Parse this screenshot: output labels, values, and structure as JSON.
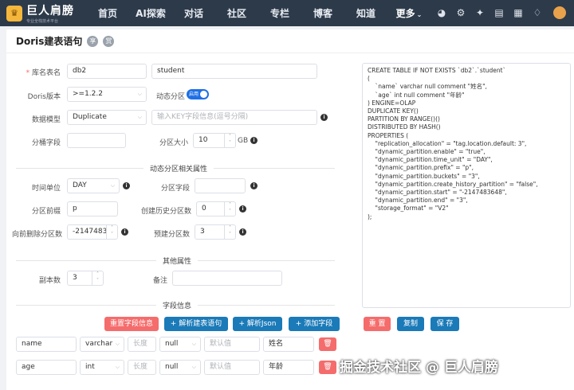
{
  "topbar": {
    "logo_text": "巨人肩膀",
    "logo_sub": "专业全栈技术平台",
    "nav": [
      "首页",
      "AI探索",
      "对话",
      "社区",
      "专栏",
      "博客",
      "知道",
      "更多"
    ],
    "icons": [
      "dashboard-icon",
      "robot-icon",
      "magic-wand-icon",
      "document-icon",
      "calendar-icon",
      "bell-icon",
      "avatar"
    ]
  },
  "page": {
    "title": "Doris建表语句",
    "circle_btn_1": "享",
    "circle_btn_2": "赏"
  },
  "form": {
    "db_label": "库名表名",
    "db_value": "db2",
    "table_value": "student",
    "version_label": "Doris版本",
    "version_value": ">=1.2.2",
    "dynamic_label": "动态分区",
    "dynamic_toggle": "启用",
    "model_label": "数据模型",
    "model_value": "Duplicate",
    "key_placeholder": "输入KEY字段信息(逗号分隔)",
    "bucket_label": "分桶字段",
    "bucket_value": "",
    "partsize_label": "分区大小",
    "partsize_value": "10",
    "partsize_unit": "GB"
  },
  "dynamic": {
    "section_title": "动态分区相关属性",
    "timeunit_label": "时间单位",
    "timeunit_value": "DAY",
    "partfield_label": "分区字段",
    "partfield_value": "",
    "prefix_label": "分区前缀",
    "prefix_value": "p",
    "history_label": "创建历史分区数",
    "history_value": "0",
    "start_label": "向前删除分区数",
    "start_value": "-2147483",
    "end_label": "预建分区数",
    "end_value": "3"
  },
  "other": {
    "section_title": "其他属性",
    "replica_label": "副本数",
    "replica_value": "3",
    "comment_label": "备注",
    "comment_value": ""
  },
  "fields": {
    "section_title": "字段信息",
    "btn_reset": "重置字段信息",
    "btn_parse": "+ 解析建表语句",
    "btn_json": "+ 解析Json",
    "btn_add": "+ 添加字段",
    "length_placeholder": "长度",
    "default_placeholder": "默认值",
    "rows": [
      {
        "name": "name",
        "type": "varchar",
        "null": "null",
        "comment": "姓名"
      },
      {
        "name": "age",
        "type": "int",
        "null": "null",
        "comment": "年龄"
      }
    ]
  },
  "sql": {
    "text": "CREATE TABLE IF NOT EXISTS `db2`.`student`\n(\n    `name` varchar null comment \"姓名\",\n    `age` int null comment \"年龄\"\n) ENGINE=OLAP\nDUPLICATE KEY()\nPARTITION BY RANGE()()\nDISTRIBUTED BY HASH()\nPROPERTIES (\n    \"replication_allocation\" = \"tag.location.default: 3\",\n    \"dynamic_partition.enable\" = \"true\",\n    \"dynamic_partition.time_unit\" = \"DAY\",\n    \"dynamic_partition.prefix\" = \"p\",\n    \"dynamic_partition.buckets\" = \"3\",\n    \"dynamic_partition.create_history_partition\" = \"false\",\n    \"dynamic_partition.start\" = \"-2147483648\",\n    \"dynamic_partition.end\" = \"3\",\n    \"storage_format\" = \"V2\"\n);",
    "btn_reset": "重 置",
    "btn_copy": "复制",
    "btn_save": "保 存"
  },
  "watermark": "掘金技术社区 @ 巨人肩膀"
}
